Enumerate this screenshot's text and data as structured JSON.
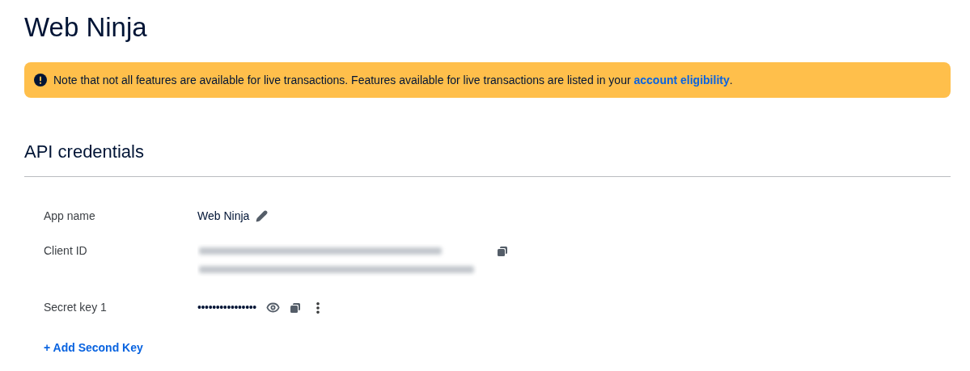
{
  "page_title": "Web Ninja",
  "notice": {
    "text": "Note that not all features are available for live transactions. Features available for live transactions are listed in your ",
    "link": "account eligibility",
    "end": "."
  },
  "section_title": "API credentials",
  "rows": [
    {
      "kind": "name",
      "label": "App name",
      "value": "Web Ninja"
    },
    {
      "kind": "blurred",
      "label": "Client ID"
    },
    {
      "kind": "secret",
      "label": "Secret key 1",
      "value": "••••••••••••••••"
    }
  ],
  "add_link": "+ Add Second Key"
}
